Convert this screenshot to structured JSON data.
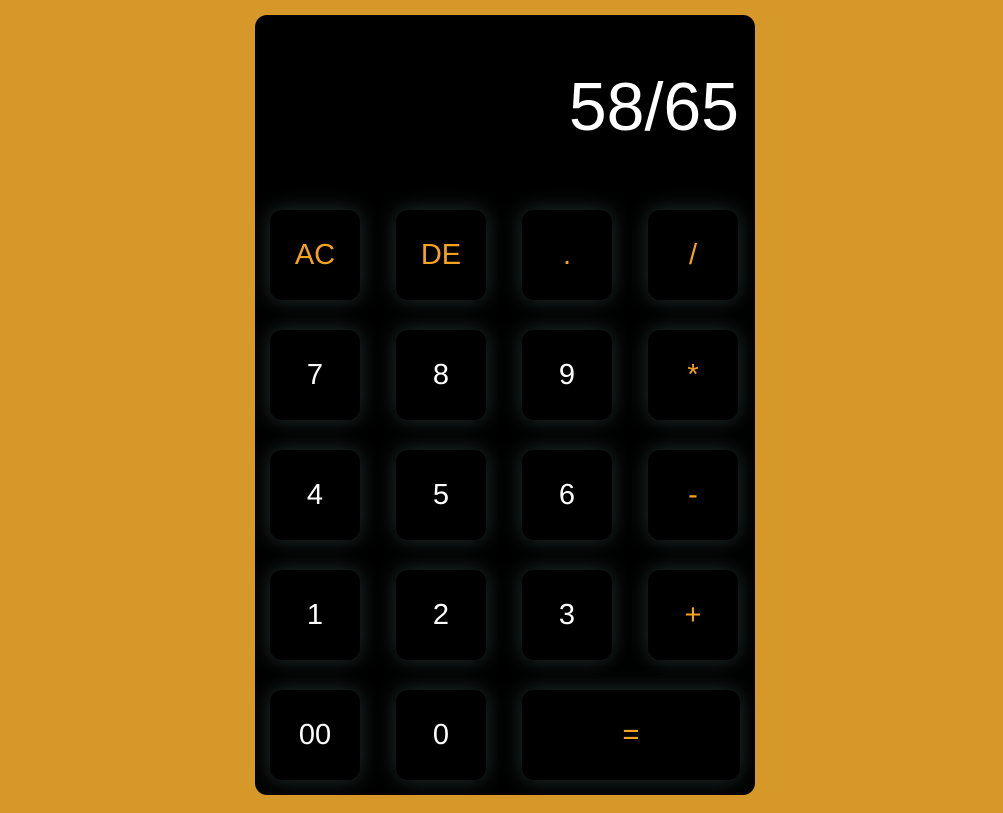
{
  "display": {
    "value": "58/65"
  },
  "keys": {
    "ac": "AC",
    "de": "DE",
    "dot": ".",
    "divide": "/",
    "seven": "7",
    "eight": "8",
    "nine": "9",
    "multiply": "*",
    "four": "4",
    "five": "5",
    "six": "6",
    "minus": "-",
    "one": "1",
    "two": "2",
    "three": "3",
    "plus": "+",
    "double_zero": "00",
    "zero": "0",
    "equals": "="
  },
  "colors": {
    "background": "#d69828",
    "calculator_body": "#000000",
    "digit_text": "#ffffff",
    "operator_text": "#f5a21c",
    "key_glow": "#608c88"
  }
}
